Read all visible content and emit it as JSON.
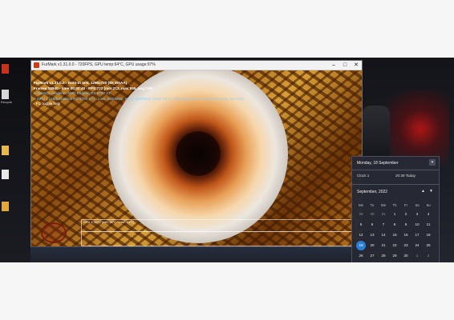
{
  "window": {
    "title": "FurMark v1.31.0.0 - 720FPS, GPU temp:64°C, GPU usage:97%",
    "min": "–",
    "max": "□",
    "close": "✕"
  },
  "overlay": {
    "line1": "FurMark v1.31.0.0 - Burn-in test, 1280x720 (8X MSAA)",
    "line2": "Frames:58940 - time:00:02:40 - FPS:722 (min:213, max:855, avg:729)",
    "line3": "> OpenGL renderer: AMD Radeon RX 6700 XT",
    "line4": "> GPU 1 (AMD Radeon RX 6700 XT) - core: 2600MHz, mem: 1000MHz, temp: 64°C, GPU load: 97%, mem used: 1GB, fan: 53%",
    "line5": "- F1: toggle help"
  },
  "graph": {
    "label": "GPU 1: 64°C (min: 34°C - max: 64°C)"
  },
  "desktop": {
    "labels": [
      "",
      "Recycle",
      "",
      "",
      "",
      ""
    ]
  },
  "flyout": {
    "date_heading": "Monday, 18 September",
    "clock_name": "Clock 1",
    "clock_time": "20:39 Today",
    "month_label": "September, 2022",
    "nav_up": "▲",
    "nav_down": "▼",
    "collapse": "▾",
    "weekdays": [
      "Mo",
      "Tu",
      "We",
      "Th",
      "Fr",
      "Sa",
      "Su"
    ],
    "weeks": [
      [
        "29",
        "30",
        "31",
        "1",
        "2",
        "3",
        "4"
      ],
      [
        "5",
        "6",
        "7",
        "8",
        "9",
        "10",
        "11"
      ],
      [
        "12",
        "13",
        "14",
        "15",
        "16",
        "17",
        "18"
      ],
      [
        "19",
        "20",
        "21",
        "22",
        "23",
        "24",
        "25"
      ],
      [
        "26",
        "27",
        "28",
        "29",
        "30",
        "1",
        "2"
      ]
    ],
    "today": "19",
    "accent_color": "#2a7fd9"
  }
}
